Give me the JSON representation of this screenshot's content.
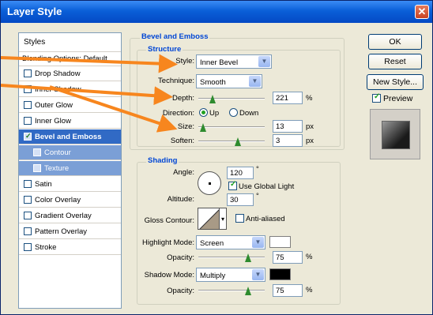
{
  "window": {
    "title": "Layer Style",
    "close_glyph": "✕"
  },
  "left_panel": {
    "styles_label": "Styles",
    "blending_label": "Blending Options: Default",
    "items": [
      {
        "label": "Drop Shadow",
        "checked": false
      },
      {
        "label": "Inner Shadow",
        "checked": false
      },
      {
        "label": "Outer Glow",
        "checked": false
      },
      {
        "label": "Inner Glow",
        "checked": false
      },
      {
        "label": "Bevel and Emboss",
        "checked": true
      },
      {
        "label": "Contour",
        "checked": false
      },
      {
        "label": "Texture",
        "checked": false
      },
      {
        "label": "Satin",
        "checked": false
      },
      {
        "label": "Color Overlay",
        "checked": false
      },
      {
        "label": "Gradient Overlay",
        "checked": false
      },
      {
        "label": "Pattern Overlay",
        "checked": false
      },
      {
        "label": "Stroke",
        "checked": false
      }
    ]
  },
  "bevel": {
    "title": "Bevel and Emboss",
    "structure_title": "Structure",
    "style_label": "Style:",
    "style_value": "Inner Bevel",
    "technique_label": "Technique:",
    "technique_value": "Smooth",
    "depth_label": "Depth:",
    "depth_value": "221",
    "depth_unit": "%",
    "direction_label": "Direction:",
    "direction_up": "Up",
    "direction_down": "Down",
    "size_label": "Size:",
    "size_value": "13",
    "size_unit": "px",
    "soften_label": "Soften:",
    "soften_value": "3",
    "soften_unit": "px"
  },
  "shading": {
    "title": "Shading",
    "angle_label": "Angle:",
    "angle_value": "120",
    "angle_unit": "°",
    "global_light_label": "Use Global Light",
    "altitude_label": "Altitude:",
    "altitude_value": "30",
    "altitude_unit": "°",
    "gloss_label": "Gloss Contour:",
    "anti_aliased_label": "Anti-aliased",
    "highlight_mode_label": "Highlight Mode:",
    "highlight_mode_value": "Screen",
    "highlight_opacity_label": "Opacity:",
    "highlight_opacity_value": "75",
    "highlight_opacity_unit": "%",
    "shadow_mode_label": "Shadow Mode:",
    "shadow_mode_value": "Multiply",
    "shadow_opacity_label": "Opacity:",
    "shadow_opacity_value": "75",
    "shadow_opacity_unit": "%"
  },
  "buttons": {
    "ok": "OK",
    "reset": "Reset",
    "new_style": "New Style...",
    "preview": "Preview"
  },
  "colors": {
    "accent": "#316ac5",
    "title_text": "#0046d5",
    "annotation_arrow": "#f7861e",
    "highlight_color": "#ffffff",
    "shadow_color": "#000000"
  },
  "slider_levels": {
    "depth": 0.22,
    "size": 0.07,
    "soften": 0.6,
    "highlight_opacity": 0.75,
    "shadow_opacity": 0.75
  }
}
